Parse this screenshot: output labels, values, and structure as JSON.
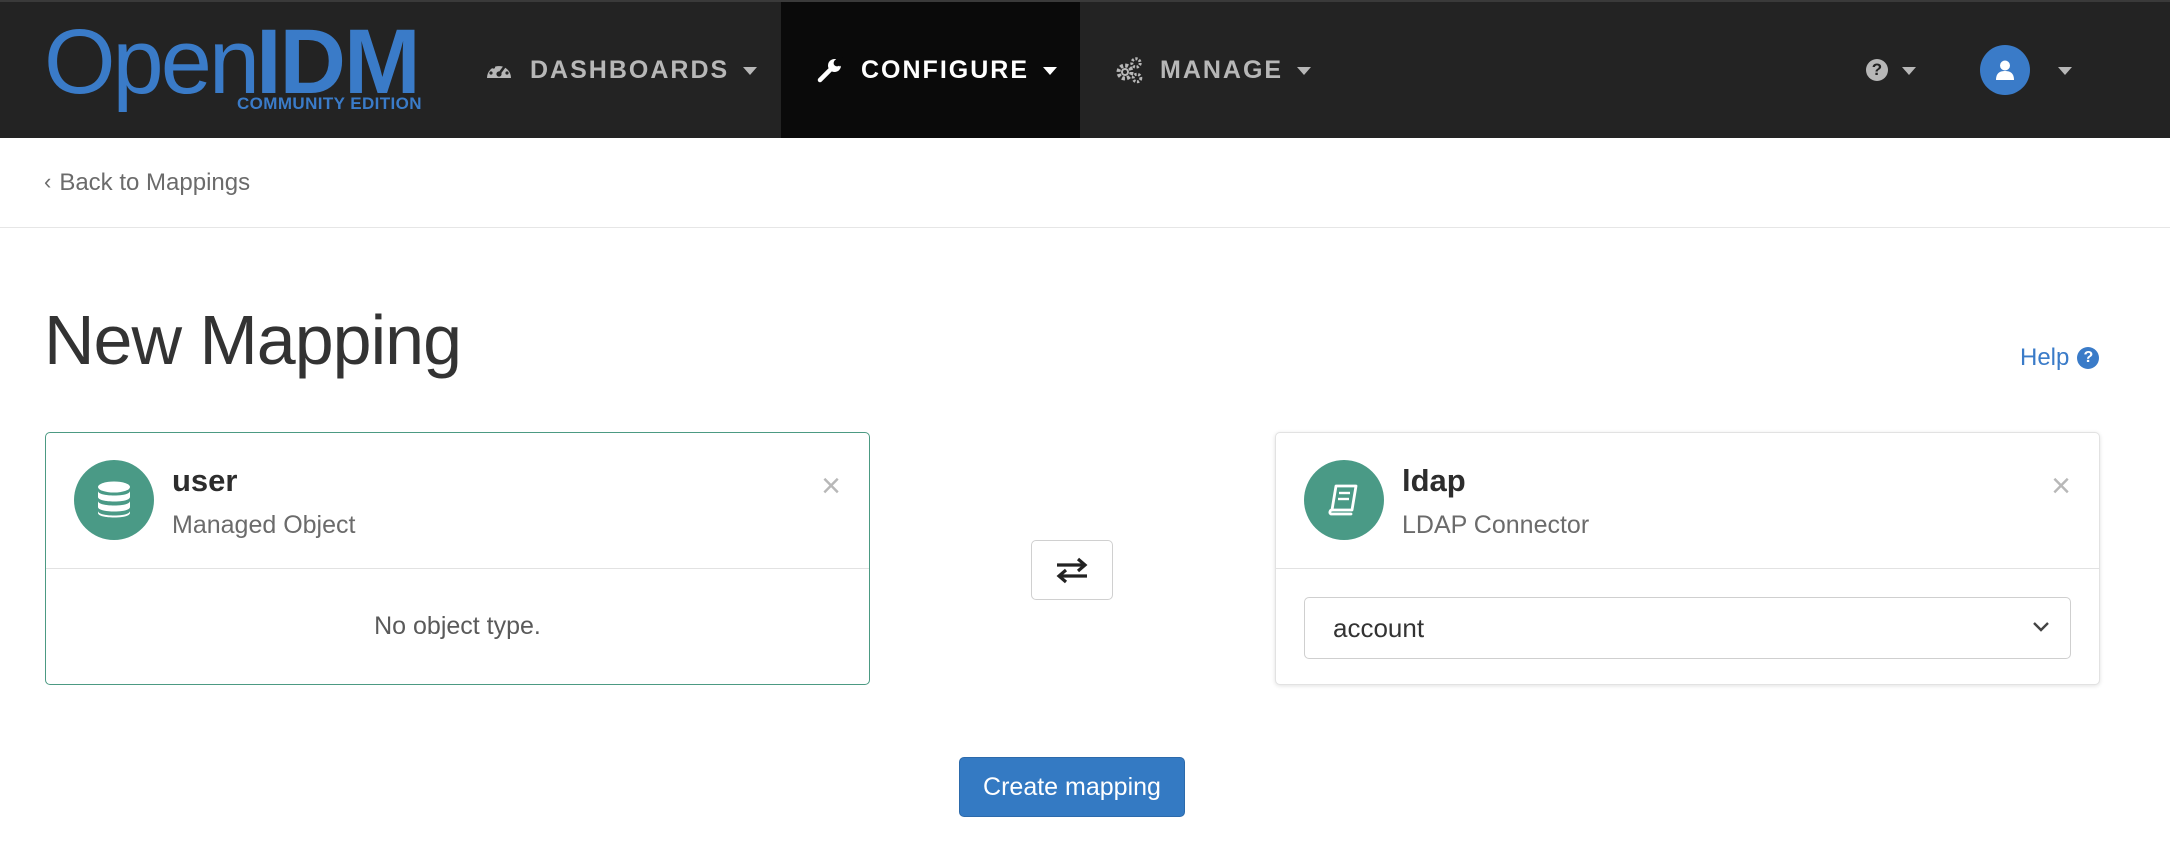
{
  "brand": {
    "logo_open": "Open",
    "logo_idm": "IDM",
    "logo_edition": "COMMUNITY EDITION"
  },
  "nav": {
    "items": [
      {
        "label": "DASHBOARDS",
        "icon": "dashboard-gauge-icon",
        "active": false
      },
      {
        "label": "CONFIGURE",
        "icon": "wrench-icon",
        "active": true
      },
      {
        "label": "MANAGE",
        "icon": "cogs-icon",
        "active": false
      }
    ],
    "help_icon": "question-circle-icon",
    "user_icon": "user-avatar-icon"
  },
  "subbar": {
    "back_label": "Back to Mappings"
  },
  "page": {
    "title": "New Mapping",
    "help_label": "Help"
  },
  "source": {
    "name": "user",
    "type": "Managed Object",
    "icon": "database-icon",
    "empty_text": "No object type."
  },
  "target": {
    "name": "ldap",
    "type": "LDAP Connector",
    "icon": "book-icon",
    "object_type": "account"
  },
  "actions": {
    "swap_icon": "exchange-arrows-icon",
    "create_label": "Create mapping"
  },
  "colors": {
    "navbar_bg": "#232323",
    "active_nav_bg": "#0a0a0a",
    "brand_blue": "#3a7bc8",
    "card_icon_green": "#4a9a86",
    "primary_button": "#347ac3"
  }
}
